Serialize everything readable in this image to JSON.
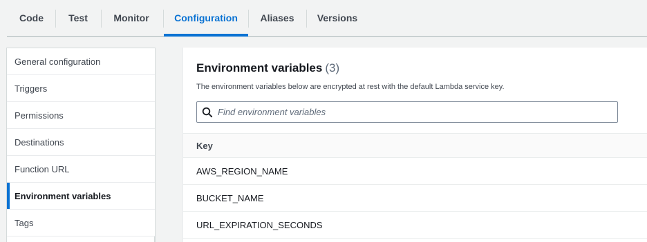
{
  "tabs": [
    {
      "label": "Code"
    },
    {
      "label": "Test"
    },
    {
      "label": "Monitor"
    },
    {
      "label": "Configuration",
      "active": true
    },
    {
      "label": "Aliases"
    },
    {
      "label": "Versions"
    }
  ],
  "sidebar": {
    "items": [
      {
        "label": "General configuration"
      },
      {
        "label": "Triggers"
      },
      {
        "label": "Permissions"
      },
      {
        "label": "Destinations"
      },
      {
        "label": "Function URL"
      },
      {
        "label": "Environment variables",
        "active": true
      },
      {
        "label": "Tags"
      }
    ]
  },
  "panel": {
    "title": "Environment variables",
    "count": "(3)",
    "description": "The environment variables below are encrypted at rest with the default Lambda service key.",
    "search_placeholder": "Find environment variables",
    "search_value": ""
  },
  "table": {
    "columns": [
      "Key"
    ],
    "rows": [
      {
        "key": "AWS_REGION_NAME"
      },
      {
        "key": "BUCKET_NAME"
      },
      {
        "key": "URL_EXPIRATION_SECONDS"
      }
    ]
  },
  "colors": {
    "accent": "#0972d3",
    "background": "#f2f3f3",
    "panel": "#ffffff",
    "text": "#16191f",
    "muted_text": "#5f6b7a"
  },
  "icons": {
    "search": "search-icon"
  }
}
